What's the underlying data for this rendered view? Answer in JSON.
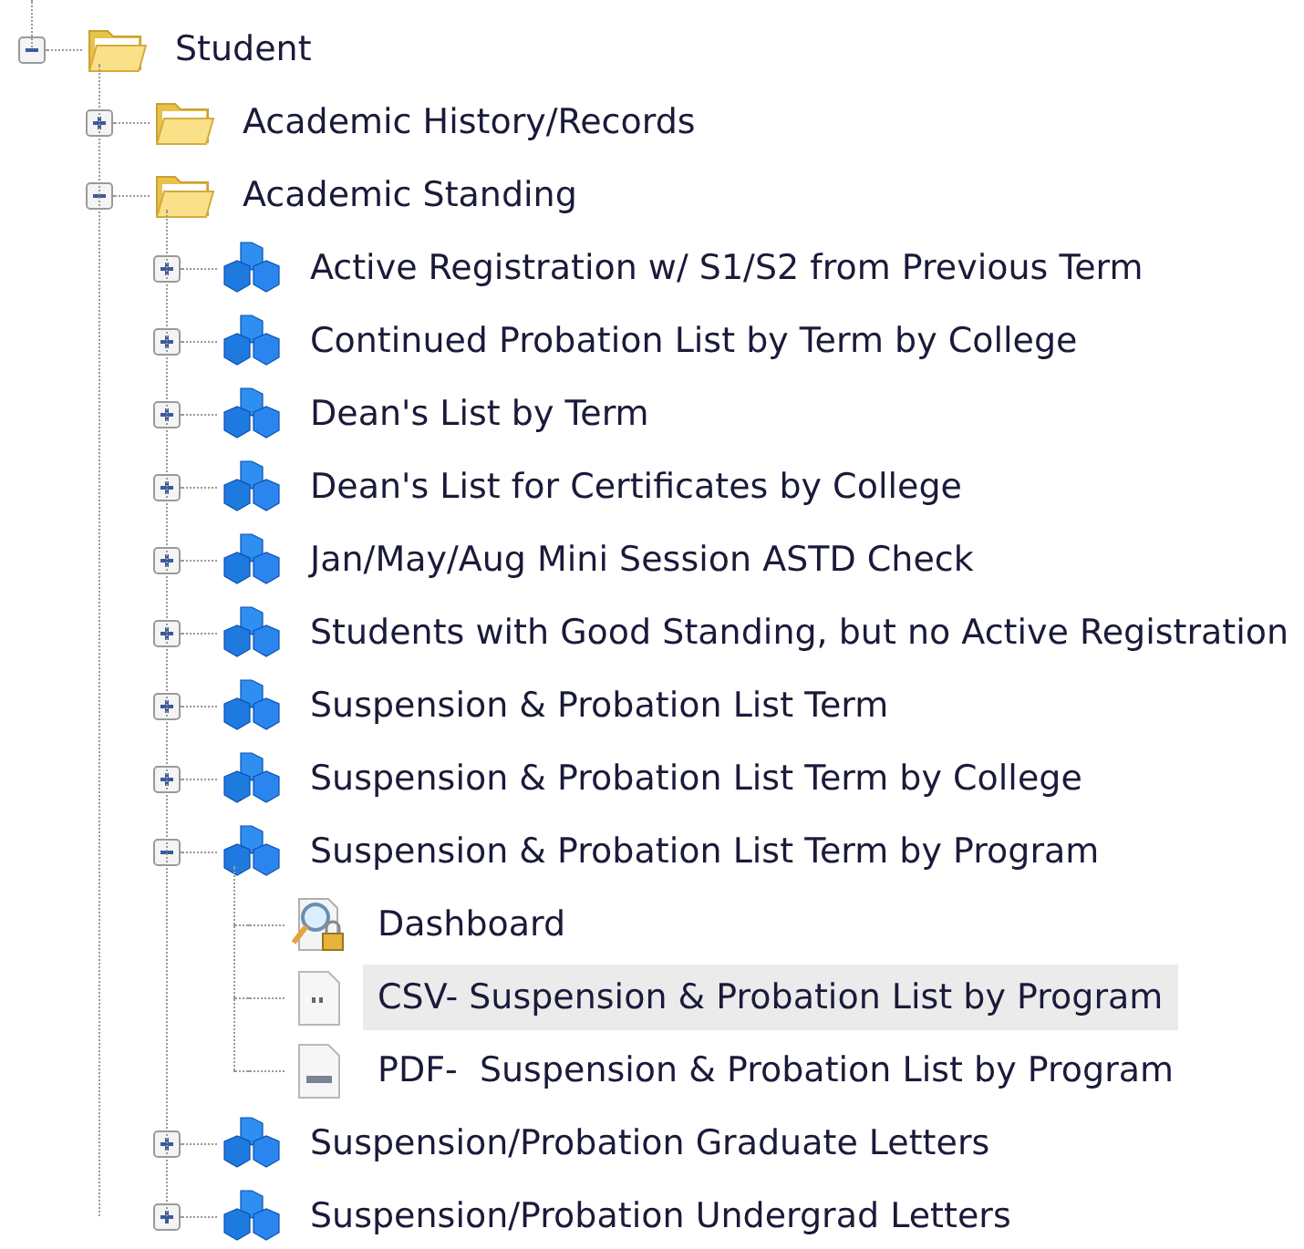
{
  "tree": [
    {
      "label": "Student",
      "kind": "folder",
      "expanded": true,
      "selected": false,
      "children": [
        {
          "label": "Academic History/Records",
          "kind": "folder",
          "expanded": false,
          "selected": false
        },
        {
          "label": "Academic Standing",
          "kind": "folder",
          "expanded": true,
          "selected": false,
          "children": [
            {
              "label": "Active Registration w/ S1/S2 from Previous Term",
              "kind": "cube",
              "expanded": false,
              "selected": false
            },
            {
              "label": "Continued Probation List by Term by College",
              "kind": "cube",
              "expanded": false,
              "selected": false
            },
            {
              "label": "Dean's List by Term",
              "kind": "cube",
              "expanded": false,
              "selected": false
            },
            {
              "label": "Dean's List for Certificates by College",
              "kind": "cube",
              "expanded": false,
              "selected": false
            },
            {
              "label": "Jan/May/Aug Mini Session ASTD Check",
              "kind": "cube",
              "expanded": false,
              "selected": false
            },
            {
              "label": "Students with Good Standing, but no Active Registration",
              "kind": "cube",
              "expanded": false,
              "selected": false
            },
            {
              "label": "Suspension & Probation List Term",
              "kind": "cube",
              "expanded": false,
              "selected": false
            },
            {
              "label": "Suspension & Probation List Term by College",
              "kind": "cube",
              "expanded": false,
              "selected": false
            },
            {
              "label": "Suspension & Probation List Term by Program",
              "kind": "cube",
              "expanded": true,
              "selected": false,
              "children": [
                {
                  "label": "Dashboard",
                  "kind": "dashboard",
                  "selected": false
                },
                {
                  "label": "CSV- Suspension & Probation List by Program",
                  "kind": "csv",
                  "selected": true
                },
                {
                  "label": "PDF-  Suspension & Probation List by Program",
                  "kind": "pdf",
                  "selected": false
                }
              ]
            },
            {
              "label": "Suspension/Probation Graduate Letters",
              "kind": "cube",
              "expanded": false,
              "selected": false
            },
            {
              "label": "Suspension/Probation Undergrad Letters",
              "kind": "cube",
              "expanded": false,
              "selected": false
            }
          ]
        }
      ]
    }
  ]
}
